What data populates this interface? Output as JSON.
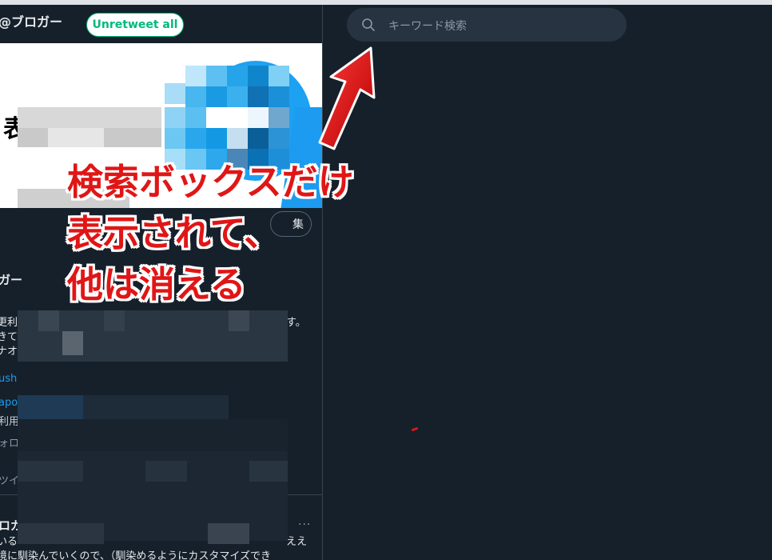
{
  "profile": {
    "handle": "@ブロガー",
    "unretweet_label": "Unretweet all",
    "edit_label": "集",
    "display_name": "ガー",
    "bio_lines": [
      "更利か",
      "きて",
      "ナオ"
    ],
    "bio_trailing": "す。",
    "link_text": "ush",
    "link2_text": "apo",
    "meta_text": "利用",
    "follow_text": "ォロ",
    "tweet_tab_text": "ツイ"
  },
  "tweet": {
    "author": "ロガ",
    "more_label": "···",
    "line1": "いる",
    "line1_trailing": "ええ",
    "line2": "境に馴染んでいくので、（馴染めるようにカスタマイズでき"
  },
  "search": {
    "placeholder": "キーワード検索"
  },
  "annotation": {
    "line1": "検索ボックスだけ",
    "line2": "表示されて、",
    "line3": "他は消える"
  },
  "colors": {
    "background": "#15202b",
    "search_bg": "#273340",
    "accent_green": "#00ba7c",
    "link_blue": "#1d9bf0",
    "annotation_red": "#e01616"
  }
}
